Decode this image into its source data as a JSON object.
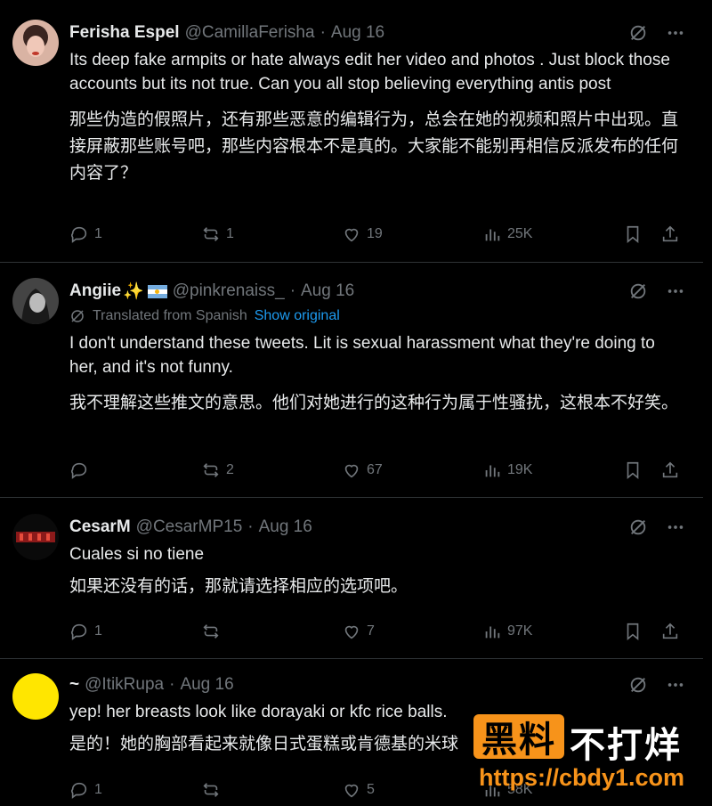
{
  "tweets": [
    {
      "name": "Ferisha Espel",
      "handle": "@CamillaFerisha",
      "sep": "·",
      "date": "Aug 16",
      "text_en": "Its deep fake armpits or hate always edit her video and photos . Just block those accounts but its not true. Can you all stop believing everything antis post",
      "text_zh": "那些伪造的假照片，还有那些恶意的编辑行为，总会在她的视频和照片中出现。直接屏蔽那些账号吧，那些内容根本不是真的。大家能不能别再相信反派发布的任何内容了？",
      "replies": "1",
      "retweets": "1",
      "likes": "19",
      "views": "25K"
    },
    {
      "name": "Angiie",
      "handle": "@pinkrenaiss_",
      "sep": "·",
      "date": "Aug 16",
      "translated_label": "Translated from Spanish",
      "show_original": "Show original",
      "text_en": "I don't understand these tweets. Lit is sexual harassment what they're doing to her, and it's not funny.",
      "text_zh": "我不理解这些推文的意思。他们对她进行的这种行为属于性骚扰，这根本不好笑。",
      "replies": "",
      "retweets": "2",
      "likes": "67",
      "views": "19K"
    },
    {
      "name": "CesarM",
      "handle": "@CesarMP15",
      "sep": "·",
      "date": "Aug 16",
      "text_en": "Cuales si no tiene",
      "text_zh": "如果还没有的话，那就请选择相应的选项吧。",
      "replies": "1",
      "retweets": "",
      "likes": "7",
      "views": "97K"
    },
    {
      "name": "~",
      "handle": "@ItikRupa",
      "sep": "·",
      "date": "Aug 16",
      "text_en": "yep! her breasts look like dorayaki or kfc rice balls.",
      "text_zh": "是的！她的胸部看起来就像日式蛋糕或肯德基的米球",
      "replies": "1",
      "retweets": "",
      "likes": "5",
      "views": "58K"
    }
  ],
  "watermark": {
    "box_text": "黑料",
    "right_text": "不打烊",
    "url": "https://cbdy1.com"
  },
  "colors": {
    "background": "#000000",
    "text": "#e7e9ea",
    "muted": "#71767b",
    "link": "#1d9bf0",
    "divider": "#2f3336",
    "watermark_orange": "#f7931a"
  }
}
